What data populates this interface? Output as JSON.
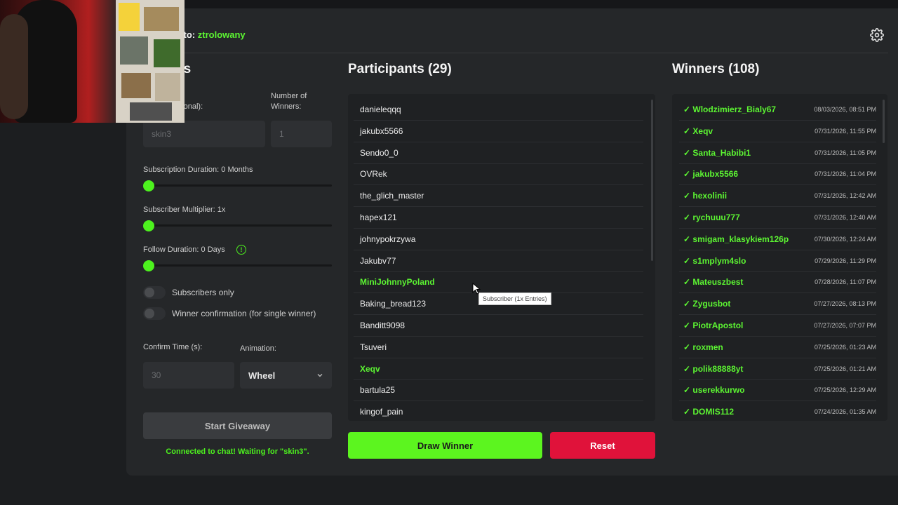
{
  "header": {
    "connected_prefix": "d to: ",
    "channel": "ztrolowany"
  },
  "settings": {
    "title": "gs",
    "keyword_label": "ptional):",
    "keyword_value": "skin3",
    "num_winners_label_1": "Number of",
    "num_winners_label_2": "Winners:",
    "num_winners_value": "1",
    "sub_duration_label": "Subscription Duration: 0 Months",
    "sub_duration_value": 0,
    "sub_multiplier_label": "Subscriber Multiplier: 1x",
    "sub_multiplier_value": 1,
    "follow_duration_label": "Follow Duration:  0  Days",
    "follow_duration_value": 0,
    "info_glyph": "!",
    "subscribers_only_label": "Subscribers only",
    "winner_confirmation_label": "Winner confirmation (for single winner)",
    "confirm_time_label": "Confirm Time (s):",
    "confirm_time_value": "30",
    "animation_label": "Animation:",
    "animation_value": "Wheel",
    "start_label": "Start Giveaway",
    "status": "Connected to chat! Waiting for \"skin3\"."
  },
  "participants": {
    "title": "Participants (29)",
    "items": [
      {
        "name": "danieleqqq",
        "sub": false
      },
      {
        "name": "jakubx5566",
        "sub": false
      },
      {
        "name": "Sendo0_0",
        "sub": false
      },
      {
        "name": "OVRek",
        "sub": false
      },
      {
        "name": "the_glich_master",
        "sub": false
      },
      {
        "name": "hapex121",
        "sub": false
      },
      {
        "name": "johnypokrzywa",
        "sub": false
      },
      {
        "name": "Jakubv77",
        "sub": false
      },
      {
        "name": "MiniJohnnyPoland",
        "sub": true
      },
      {
        "name": "Baking_bread123",
        "sub": false
      },
      {
        "name": "Banditt9098",
        "sub": false
      },
      {
        "name": "Tsuveri",
        "sub": false
      },
      {
        "name": "Xeqv",
        "sub": true
      },
      {
        "name": "bartula25",
        "sub": false
      },
      {
        "name": "kingof_pain",
        "sub": false
      }
    ],
    "tooltip": "Subscriber (1x Entries)"
  },
  "winners": {
    "title": "Winners (108)",
    "items": [
      {
        "name": "✓ Wlodzimierz_Bialy67",
        "date": "08/03/2026, 08:51 PM"
      },
      {
        "name": "✓ Xeqv",
        "date": "07/31/2026, 11:55 PM"
      },
      {
        "name": "✓ Santa_Habibi1",
        "date": "07/31/2026, 11:05 PM"
      },
      {
        "name": "✓ jakubx5566",
        "date": "07/31/2026, 11:04 PM"
      },
      {
        "name": "✓ hexolinii",
        "date": "07/31/2026, 12:42 AM"
      },
      {
        "name": "✓ rychuuu777",
        "date": "07/31/2026, 12:40 AM"
      },
      {
        "name": "✓ smigam_klasykiem126p",
        "date": "07/30/2026, 12:24 AM"
      },
      {
        "name": "✓ s1mplym4slo",
        "date": "07/29/2026, 11:29 PM"
      },
      {
        "name": "✓ Mateuszbest",
        "date": "07/28/2026, 11:07 PM"
      },
      {
        "name": "✓ Zygusbot",
        "date": "07/27/2026, 08:13 PM"
      },
      {
        "name": "✓ PiotrApostol",
        "date": "07/27/2026, 07:07 PM"
      },
      {
        "name": "✓ roxmen",
        "date": "07/25/2026, 01:23 AM"
      },
      {
        "name": "✓ polik88888yt",
        "date": "07/25/2026, 01:21 AM"
      },
      {
        "name": "✓ userekkurwo",
        "date": "07/25/2026, 12:29 AM"
      },
      {
        "name": "✓ DOMIS112",
        "date": "07/24/2026, 01:35 AM"
      }
    ]
  },
  "actions": {
    "draw_label": "Draw Winner",
    "reset_label": "Reset"
  },
  "colors": {
    "accent": "#5cf532",
    "danger": "#e0123a",
    "panel": "#252729"
  }
}
